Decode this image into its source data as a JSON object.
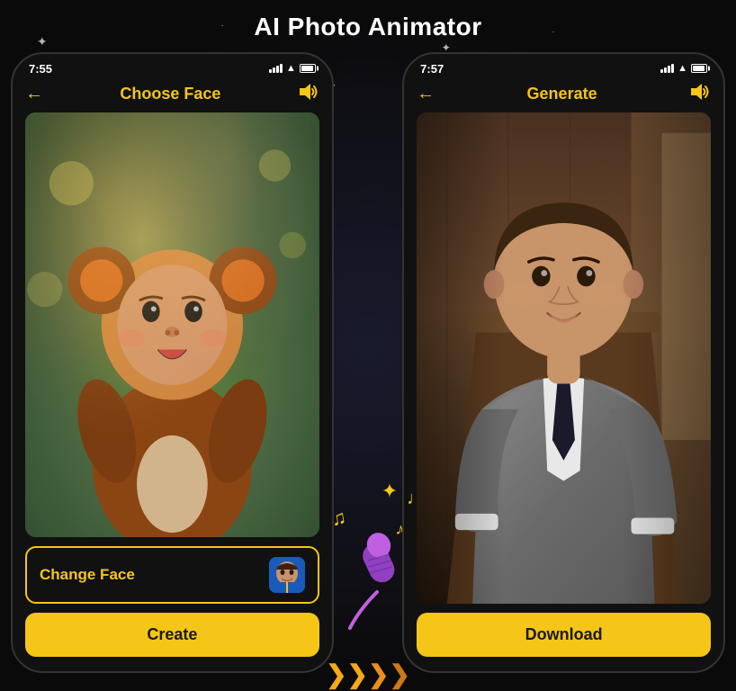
{
  "page": {
    "title": "AI Photo Animator",
    "background": "#0a0a0a"
  },
  "left_phone": {
    "status": {
      "time": "7:55",
      "signal": true,
      "wifi": true,
      "battery": true
    },
    "nav": {
      "back_label": "←",
      "title": "Choose Face",
      "sound_icon": "🔊"
    },
    "change_face_button": "Change Face",
    "create_button": "Create"
  },
  "right_phone": {
    "status": {
      "time": "7:57",
      "signal": true,
      "wifi": true,
      "battery": true
    },
    "nav": {
      "back_label": "←",
      "title": "Generate",
      "sound_icon": "🔊"
    },
    "download_button": "Download"
  },
  "decoration": {
    "notes": [
      "♪",
      "♫",
      "♩"
    ],
    "arrows": [
      "»",
      "»",
      "»"
    ],
    "sparkle": "✦"
  }
}
